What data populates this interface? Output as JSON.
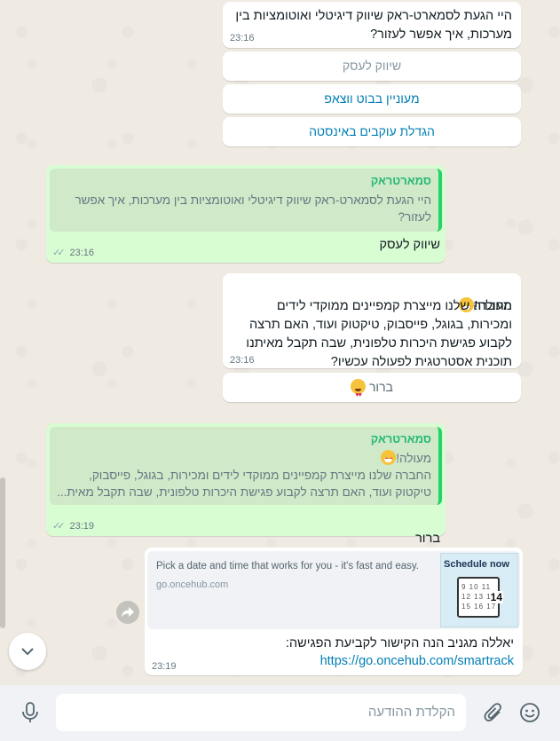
{
  "messages": {
    "m1": {
      "text": "היי הגעת לסמארט-ראק שיווק דיגיטלי ואוטומציות בין מערכות, איך אפשר לעזור?",
      "time": "23:16"
    },
    "quick_replies": [
      {
        "label": "שיווק לעסק",
        "disabled": true
      },
      {
        "label": "מעוניין בבוט ווצאפ",
        "disabled": false
      },
      {
        "label": "הגדלת עוקבים באינסטה",
        "disabled": false
      }
    ],
    "m2": {
      "quote_author": "סמארטראק",
      "quote_text": "היי הגעת לסמארט-ראק שיווק דיגיטלי ואוטומציות בין מערכות, איך אפשר לעזור?",
      "text": "שיווק לעסק",
      "time": "23:16",
      "status_icon": "double-check-icon"
    },
    "m3": {
      "first_line": "מעולה!",
      "text": "החברה שלנו מייצרת קמפיינים ממוקדי לידים ומכירות, בגוגל, פייסבוק, טיקטוק ועוד, האם תרצה לקבוע פגישת היכרות טלפונית, שבה תקבל מאיתנו תוכנית אסטרטגית לפעולה עכשיו?",
      "time": "23:16",
      "button_label": "ברור"
    },
    "m4": {
      "quote_author": "סמארטראק",
      "quote_first_line": "מעולה!",
      "quote_text": "החברה שלנו מייצרת קמפיינים ממוקדי לידים ומכירות, בגוגל, פייסבוק, טיקטוק ועוד, האם תרצה לקבוע פגישת היכרות טלפונית, שבה תקבל מאית...",
      "text": "ברור",
      "time": "23:19",
      "status_icon": "double-check-icon"
    },
    "m5": {
      "link_title": "Pick a date and time that works for you - it's fast and easy.",
      "link_domain": "go.oncehub.com",
      "thumb_title": "Schedule now",
      "thumb_cal_numbers": "9 10 11\n12 13 14\n15 16 17",
      "thumb_cal_big": "14",
      "text": "יאללה מגניב הנה הקישור לקביעת הפגישה:",
      "url": "https://go.oncehub.com/smartrack",
      "time": "23:19"
    }
  },
  "composer": {
    "placeholder": "הקלדת ההודעה",
    "icons": [
      "emoji-icon",
      "attach-icon",
      "microphone-icon"
    ]
  },
  "colors": {
    "incoming": "#ffffff",
    "outgoing": "#d9fdd3",
    "link": "#027eb5",
    "quote_author": "#25b873"
  }
}
